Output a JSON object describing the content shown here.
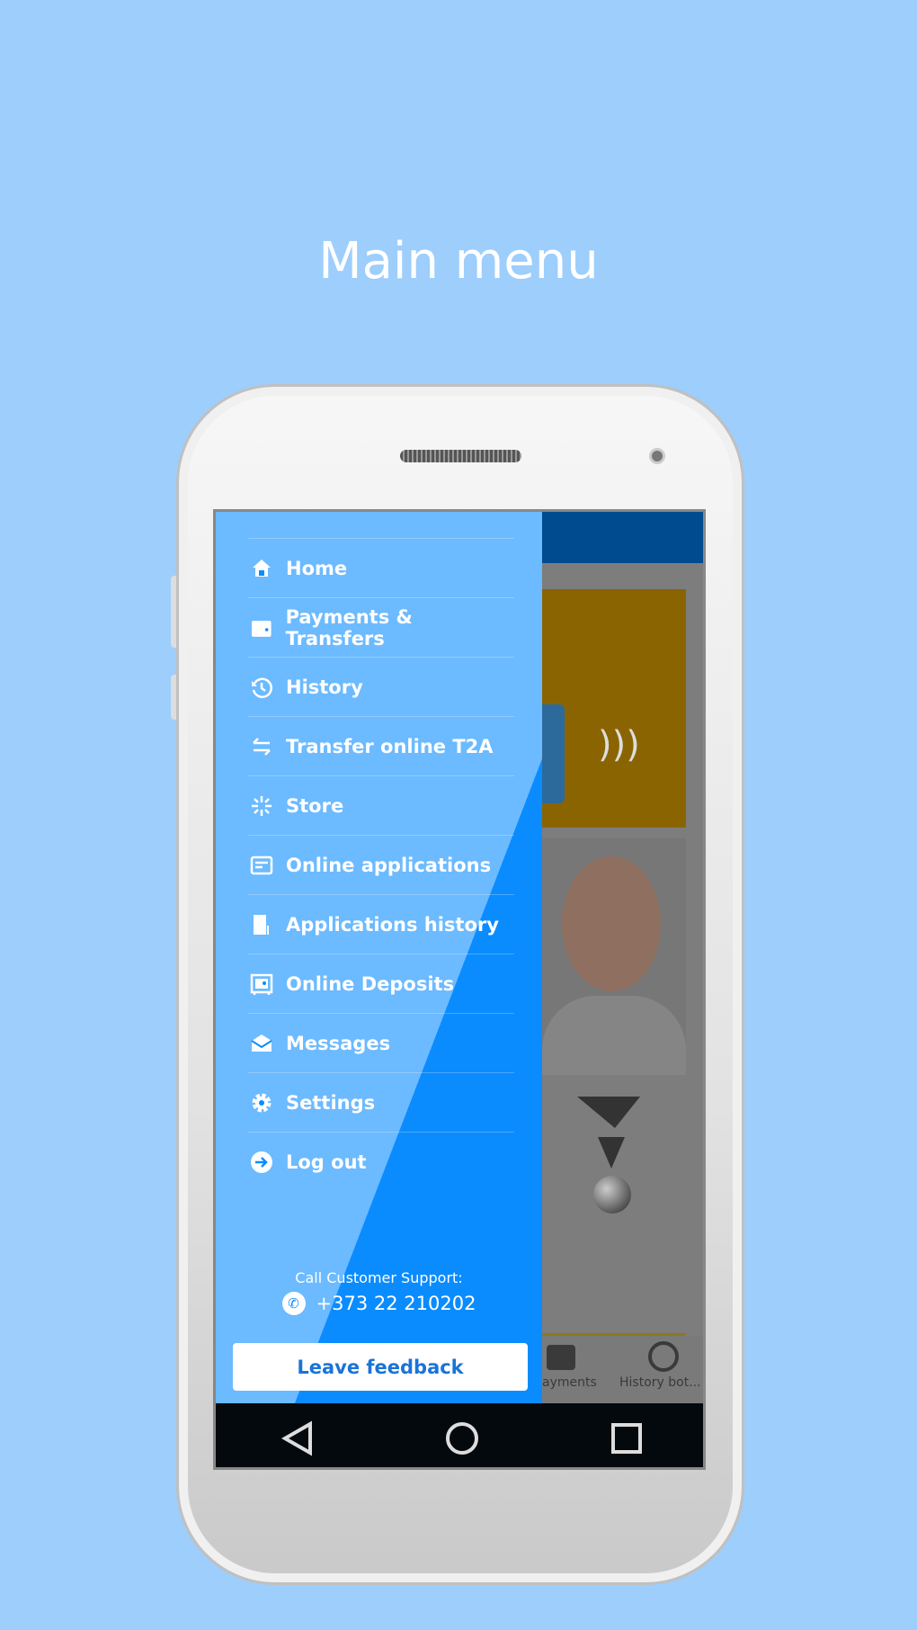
{
  "title": "Main menu",
  "drawer": {
    "items": [
      {
        "label": "Home",
        "icon": "home-icon"
      },
      {
        "label": "Payments & Transfers",
        "icon": "wallet-icon"
      },
      {
        "label": "History",
        "icon": "history-icon"
      },
      {
        "label": "Transfer online T2A",
        "icon": "transfer-arrows-icon"
      },
      {
        "label": "Store",
        "icon": "store-sparkle-icon"
      },
      {
        "label": "Online applications",
        "icon": "document-icon"
      },
      {
        "label": "Applications history",
        "icon": "receipt-icon"
      },
      {
        "label": "Online Deposits",
        "icon": "safe-icon"
      },
      {
        "label": "Messages",
        "icon": "envelope-icon"
      },
      {
        "label": "Settings",
        "icon": "gear-icon"
      },
      {
        "label": "Log out",
        "icon": "logout-icon"
      }
    ],
    "support_label": "Call Customer Support:",
    "support_phone": "+373 22 210202",
    "feedback_label": "Leave feedback"
  },
  "background": {
    "bottom_nav": [
      "ayments",
      "History bot..."
    ]
  },
  "colors": {
    "drawer": "#0a8cff",
    "page_bg": "#9dcefc",
    "header": "#004a8f",
    "card": "#8a6400"
  }
}
